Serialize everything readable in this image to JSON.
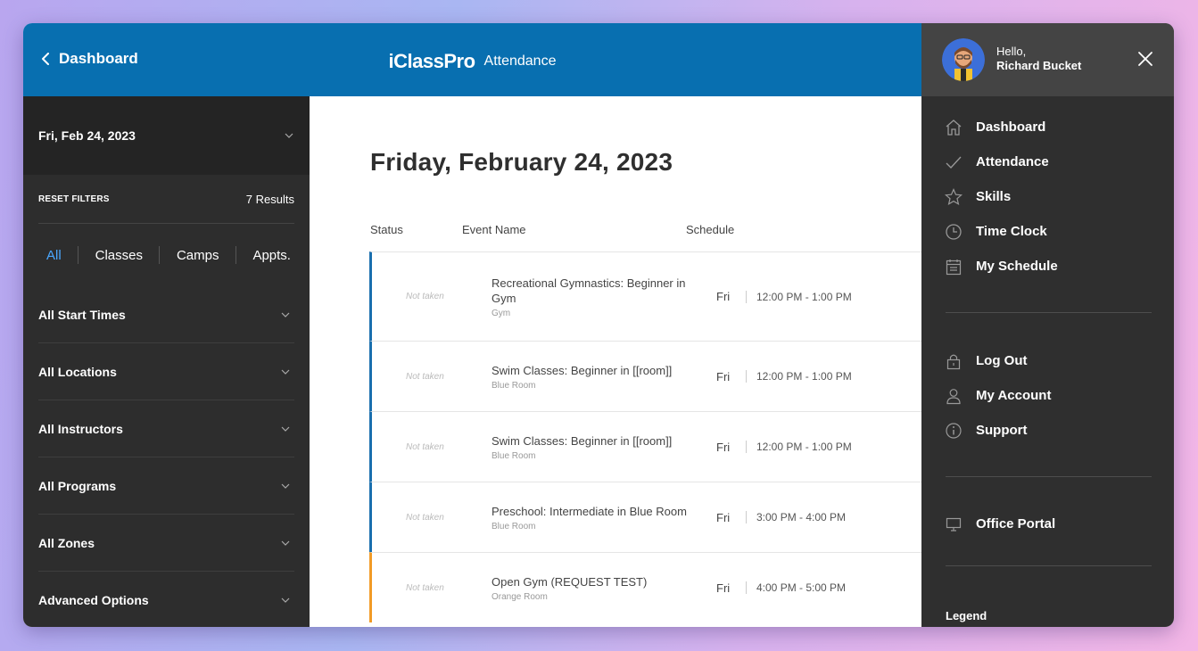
{
  "header": {
    "back_label": "Dashboard",
    "brand": "iClassPro",
    "brand_sub": "Attendance"
  },
  "sidebar": {
    "date": "Fri, Feb 24, 2023",
    "reset_filters": "RESET FILTERS",
    "results": "7 Results",
    "tabs": [
      "All",
      "Classes",
      "Camps",
      "Appts."
    ],
    "filters": [
      "All Start Times",
      "All Locations",
      "All Instructors",
      "All Programs",
      "All Zones",
      "Advanced Options"
    ]
  },
  "main": {
    "title": "Friday, February 24, 2023",
    "columns": {
      "status": "Status",
      "event": "Event Name",
      "schedule": "Schedule"
    },
    "rows": [
      {
        "status": "Not taken",
        "name": "Recreational Gymnastics: Beginner in Gym",
        "location": "Gym",
        "day": "Fri",
        "time": "12:00 PM - 1:00 PM"
      },
      {
        "status": "Not taken",
        "name": "Swim Classes: Beginner in [[room]]",
        "location": "Blue Room",
        "day": "Fri",
        "time": "12:00 PM - 1:00 PM"
      },
      {
        "status": "Not taken",
        "name": "Swim Classes: Beginner in [[room]]",
        "location": "Blue Room",
        "day": "Fri",
        "time": "12:00 PM - 1:00 PM"
      },
      {
        "status": "Not taken",
        "name": "Preschool: Intermediate in Blue Room",
        "location": "Blue Room",
        "day": "Fri",
        "time": "3:00 PM - 4:00 PM"
      },
      {
        "status": "Not taken",
        "name": "Open Gym (REQUEST TEST)",
        "location": "Orange Room",
        "day": "Fri",
        "time": "4:00 PM - 5:00 PM"
      }
    ]
  },
  "drawer": {
    "hello": "Hello,",
    "user_name": "Richard Bucket",
    "menu_main": [
      {
        "label": "Dashboard",
        "icon": "home-icon"
      },
      {
        "label": "Attendance",
        "icon": "check-icon"
      },
      {
        "label": "Skills",
        "icon": "star-icon"
      },
      {
        "label": "Time Clock",
        "icon": "clock-icon"
      },
      {
        "label": "My Schedule",
        "icon": "calendar-icon"
      }
    ],
    "menu_account": [
      {
        "label": "Log Out",
        "icon": "lock-icon"
      },
      {
        "label": "My Account",
        "icon": "user-icon"
      },
      {
        "label": "Support",
        "icon": "info-icon"
      }
    ],
    "office_portal": "Office Portal",
    "legend": "Legend"
  },
  "colors": {
    "header_blue": "#086fb0",
    "sidebar_bg": "#2d2d2d",
    "active_tab": "#4aa8ff",
    "row_blue": "#1a6fae",
    "row_orange": "#f29b26"
  }
}
